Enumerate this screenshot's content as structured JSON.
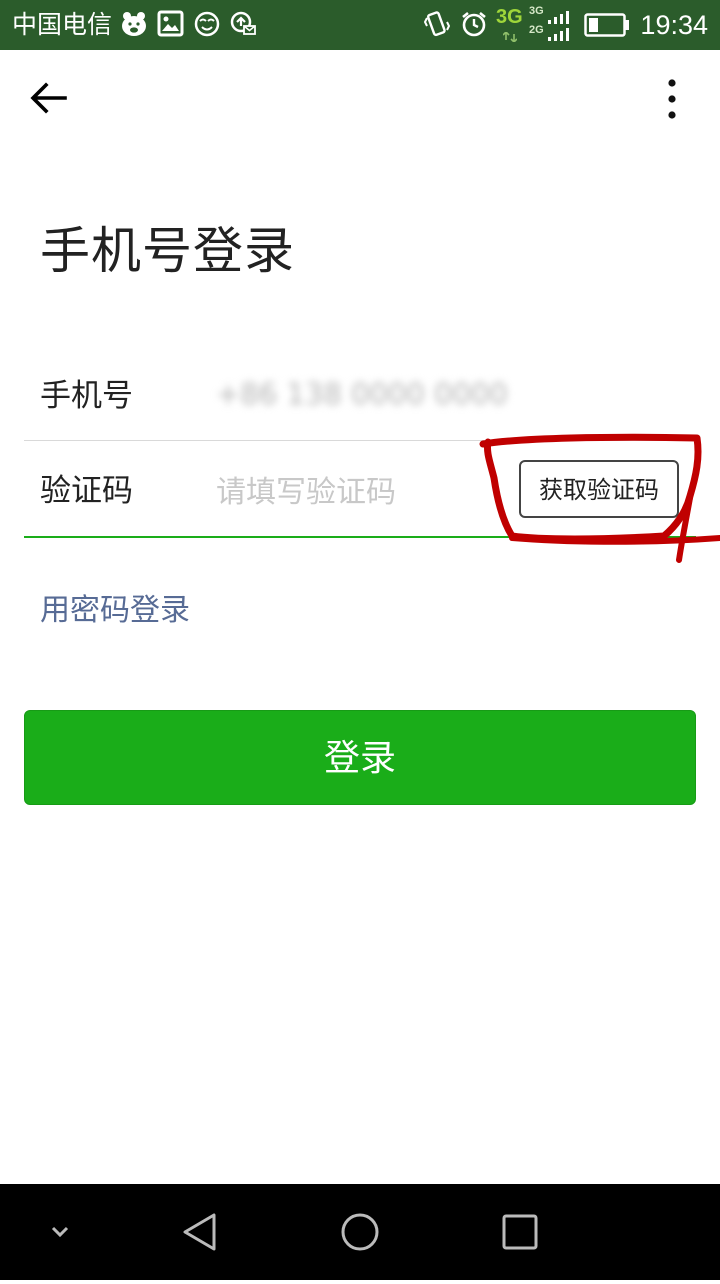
{
  "status_bar": {
    "carrier": "中国电信",
    "network": "3G",
    "network_secondary_top": "3G",
    "network_secondary_bottom": "2G",
    "time": "19:34"
  },
  "page": {
    "title": "手机号登录"
  },
  "form": {
    "phone_label": "手机号",
    "phone_value": "+86 138 0000 0000",
    "code_label": "验证码",
    "code_placeholder": "请填写验证码",
    "get_code_button": "获取验证码"
  },
  "password_login_link": "用密码登录",
  "login_button": "登录",
  "colors": {
    "status_bar_bg": "#2b5c2b",
    "primary_green": "#1aad19",
    "link_blue": "#576b95",
    "annotation_red": "#c00000",
    "focus_underline": "#1aad19"
  },
  "icons": {
    "back": "arrow-left-icon",
    "more": "more-vertical-icon",
    "nav_collapse": "chevron-down-icon",
    "nav_back": "triangle-back-icon",
    "nav_home": "circle-home-icon",
    "nav_recents": "square-recents-icon"
  }
}
